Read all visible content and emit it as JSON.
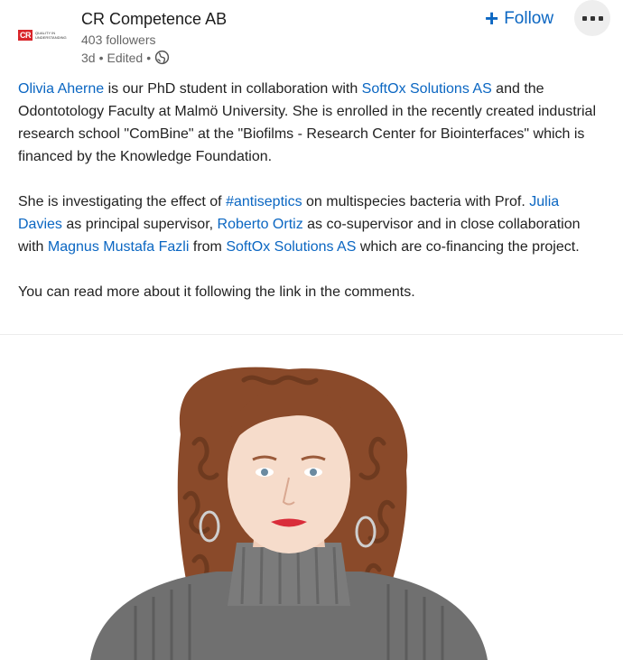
{
  "header": {
    "company_name": "CR Competence AB",
    "followers": "403 followers",
    "time": "3d",
    "edited": "Edited",
    "separator": "•",
    "logo_text": "CR",
    "logo_tagline": "Quality in Understanding",
    "follow_label": "Follow",
    "icons": {
      "follow": "plus-icon",
      "more": "more-icon",
      "visibility": "globe-icon"
    }
  },
  "post": {
    "p1": {
      "person": "Olivia Aherne",
      "t1": " is our PhD student in collaboration with ",
      "org": "SoftOx Solutions AS",
      "t2": " and the Odontotology Faculty at Malmö University. She is enrolled in the recently created industrial research school \"ComBine\" at the \"Biofilms - Research Center for Biointerfaces\" which is financed by the Knowledge Foundation."
    },
    "p2": {
      "t1": "She is investigating the effect of ",
      "hashtag": "#antiseptics",
      "t2": " on multispecies bacteria with Prof. ",
      "person1": "Julia Davies",
      "t3": " as principal supervisor, ",
      "person2": "Roberto Ortiz",
      "t4": " as co-supervisor and in close collaboration with ",
      "person3": "Magnus Mustafa Fazli",
      "t5": " from ",
      "org": "SoftOx Solutions AS",
      "t6": " which are co-financing the project."
    },
    "p3": "You can read more about it following the link in the comments."
  },
  "colors": {
    "link": "#0a66c2",
    "text": "#222222",
    "muted": "#666666",
    "brand_red": "#d9262b"
  }
}
